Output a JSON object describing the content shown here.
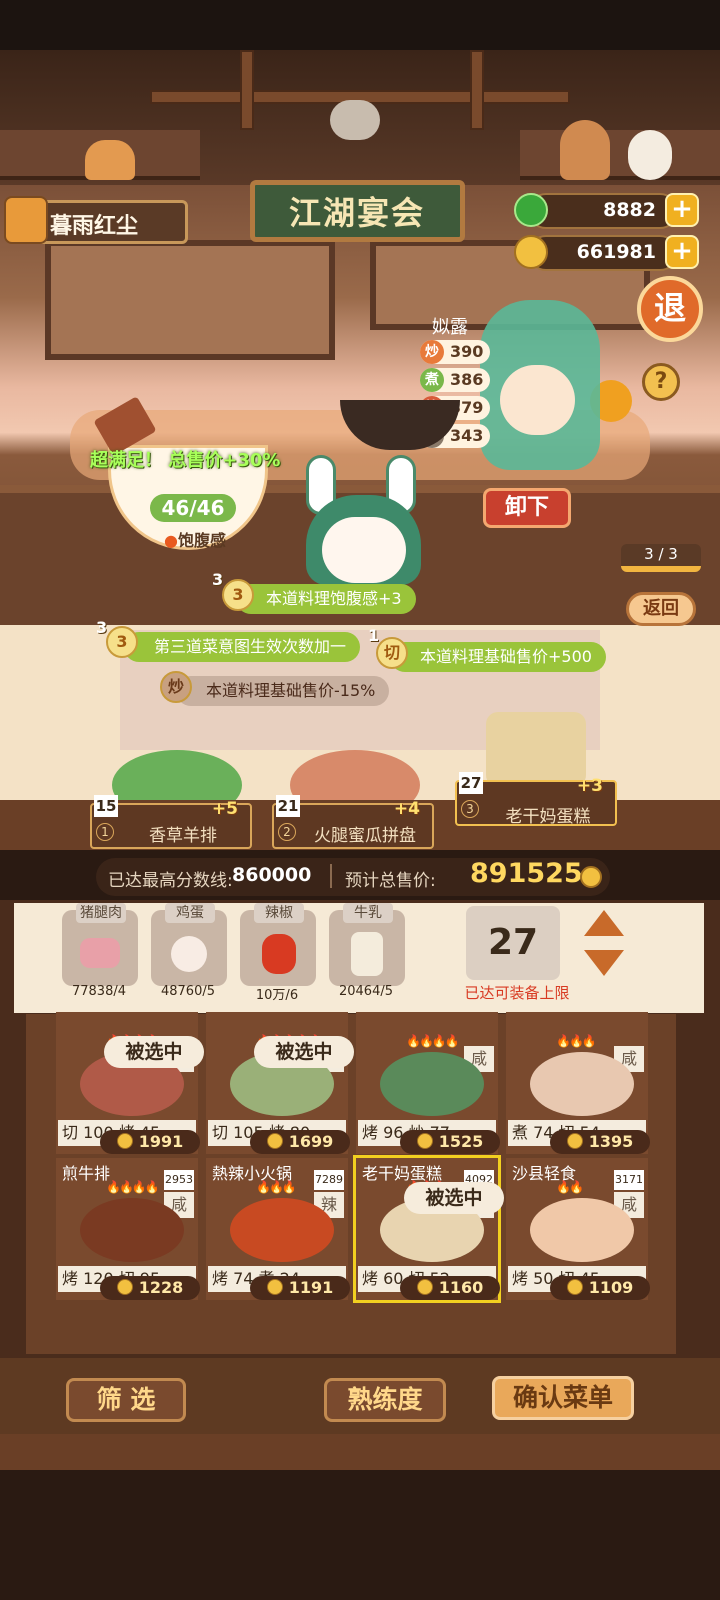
{
  "header": {
    "player_name": "暮雨红尘",
    "sign": "江湖宴会",
    "jade": "8882",
    "coins": "661981",
    "retreat": "退",
    "help": "?"
  },
  "character": {
    "name": "姒露",
    "stats": [
      {
        "icon": "炒",
        "value": "390"
      },
      {
        "icon": "煮",
        "value": "386"
      },
      {
        "icon": "烤",
        "value": "379"
      },
      {
        "icon": "切",
        "value": "343"
      }
    ]
  },
  "bowl": {
    "bonus": "超满足！ 总售价+30%",
    "satiety": "46/46",
    "satiety_label": "饱腹感"
  },
  "buttons": {
    "unload": "卸下",
    "page": "3 / 3",
    "return": "返回"
  },
  "buffs": [
    {
      "num": "3",
      "badge": "3",
      "text": "本道料理饱腹感+3"
    },
    {
      "num": "3",
      "badge": "3",
      "text": "第三道菜意图生效次数加一"
    },
    {
      "num": "1",
      "badge": "切",
      "text": "本道料理基础售价+500"
    },
    {
      "num": "",
      "badge": "炒",
      "text": "本道料理基础售价-15%"
    }
  ],
  "courses": [
    {
      "count": "15",
      "idx": "1",
      "name": "香草羊排",
      "bonus": "+5"
    },
    {
      "count": "21",
      "idx": "2",
      "name": "火腿蜜瓜拼盘",
      "bonus": "+4"
    },
    {
      "count": "27",
      "idx": "3",
      "name": "老干妈蛋糕",
      "bonus": "+3"
    }
  ],
  "score": {
    "best_label": "已达最高分数线:",
    "best": "860000",
    "total_label": "预计总售价:",
    "total": "891525"
  },
  "ingredients": [
    {
      "label": "猪腿肉",
      "count": "77838/4"
    },
    {
      "label": "鸡蛋",
      "count": "48760/5"
    },
    {
      "label": "辣椒",
      "count": "10万/6"
    },
    {
      "label": "牛乳",
      "count": "20464/5"
    }
  ],
  "capacity": {
    "value": "27",
    "label": "已达可装备上限"
  },
  "dishes": [
    {
      "name": "",
      "count": "",
      "taste": "咸",
      "flames": "🔥🔥🔥🔥",
      "stats": "切 100 烤 45",
      "price": "1991",
      "selected": "被选中",
      "color": "#b05a48"
    },
    {
      "name": "",
      "count": "",
      "taste": "咸",
      "flames": "🔥🔥🔥🔥🔥",
      "stats": "切 105 烤 80",
      "price": "1699",
      "selected": "被选中",
      "color": "#9ab078"
    },
    {
      "name": "",
      "count": "",
      "taste": "咸",
      "flames": "🔥🔥🔥🔥",
      "stats": "烤 96 炒 77",
      "price": "1525",
      "selected": "",
      "color": "#5a8a5a"
    },
    {
      "name": "",
      "count": "",
      "taste": "咸",
      "flames": "🔥🔥🔥",
      "stats": "煮 74 切 54",
      "price": "1395",
      "selected": "",
      "color": "#e8c8b0"
    },
    {
      "name": "煎牛排",
      "count": "2953",
      "taste": "咸",
      "flames": "🔥🔥🔥🔥",
      "stats": "烤 120 切 95",
      "price": "1228",
      "selected": "",
      "color": "#7a3a22"
    },
    {
      "name": "熱辣小火锅",
      "count": "7289",
      "taste": "辣",
      "flames": "🔥🔥🔥",
      "stats": "烤 74 煮 24",
      "price": "1191",
      "selected": "",
      "color": "#c84a22"
    },
    {
      "name": "老干妈蛋糕",
      "count": "4092",
      "taste": "辣",
      "flames": "🔥🔥🔥",
      "stats": "烤 60 切 52",
      "price": "1160",
      "selected": "被选中",
      "color": "#e8d4b0"
    },
    {
      "name": "沙县轻食",
      "count": "3171",
      "taste": "咸",
      "flames": "🔥🔥",
      "stats": "烤 50 切 45",
      "price": "1109",
      "selected": "",
      "color": "#f0c8a8"
    }
  ],
  "bottom": {
    "filter": "筛  选",
    "skill": "熟练度",
    "confirm": "确认菜单"
  },
  "colors": {
    "accent": "#f2b540",
    "wood": "#6b4128",
    "green": "#9ac43a"
  }
}
